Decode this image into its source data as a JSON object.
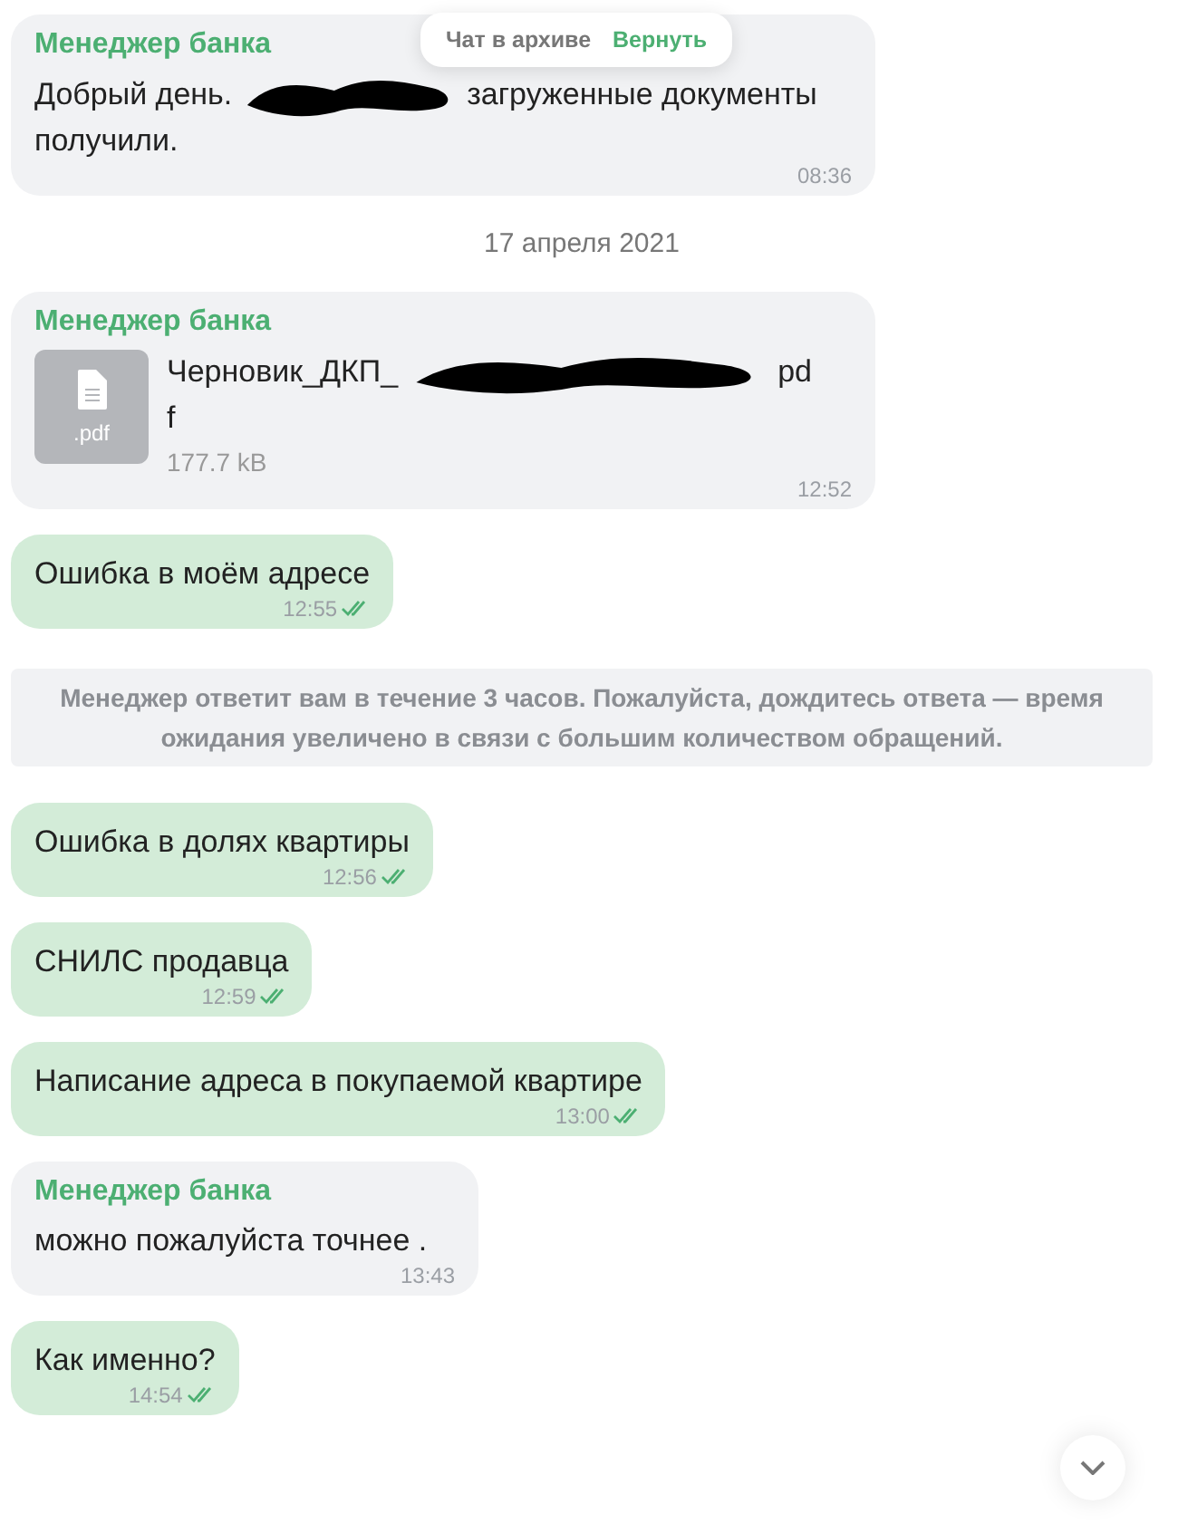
{
  "archive_popup": {
    "label": "Чат в архиве",
    "action": "Вернуть"
  },
  "messages": [
    {
      "kind": "incoming",
      "sender": "Менеджер банка",
      "parts": [
        {
          "kind": "text",
          "text": "Добрый день."
        },
        {
          "kind": "redaction"
        },
        {
          "kind": "text",
          "text": "загруженные документы получили."
        }
      ],
      "time": "08:36"
    },
    {
      "kind": "date",
      "text": "17 апреля 2021"
    },
    {
      "kind": "file",
      "sender": "Менеджер банка",
      "file_type": ".pdf",
      "name_lines": [
        [
          {
            "kind": "text",
            "text": "Черновик_ДКП_"
          },
          {
            "kind": "redaction"
          },
          {
            "kind": "text",
            "text": "pd"
          }
        ],
        [
          {
            "kind": "text",
            "text": "f"
          }
        ]
      ],
      "size": "177.7 kB",
      "time": "12:52"
    },
    {
      "kind": "outgoing",
      "text": "Ошибка в моём адресе",
      "time": "12:55",
      "read": true
    },
    {
      "kind": "notice",
      "text": "Менеджер ответит вам в течение 3 часов. Пожалуйста, дождитесь ответа — время ожидания увеличено в связи с большим количеством обращений."
    },
    {
      "kind": "outgoing",
      "text": "Ошибка в долях квартиры",
      "time": "12:56",
      "read": true
    },
    {
      "kind": "outgoing",
      "text": "СНИЛС продавца",
      "time": "12:59",
      "read": true
    },
    {
      "kind": "outgoing",
      "text": "Написание адреса в покупаемой квартире",
      "time": "13:00",
      "read": true
    },
    {
      "kind": "incoming",
      "sender": "Менеджер банка",
      "parts": [
        {
          "kind": "text",
          "text": "можно пожалуйста точнее ."
        }
      ],
      "time": "13:43"
    },
    {
      "kind": "outgoing",
      "text": "Как именно?",
      "time": "14:54",
      "read": true
    }
  ]
}
